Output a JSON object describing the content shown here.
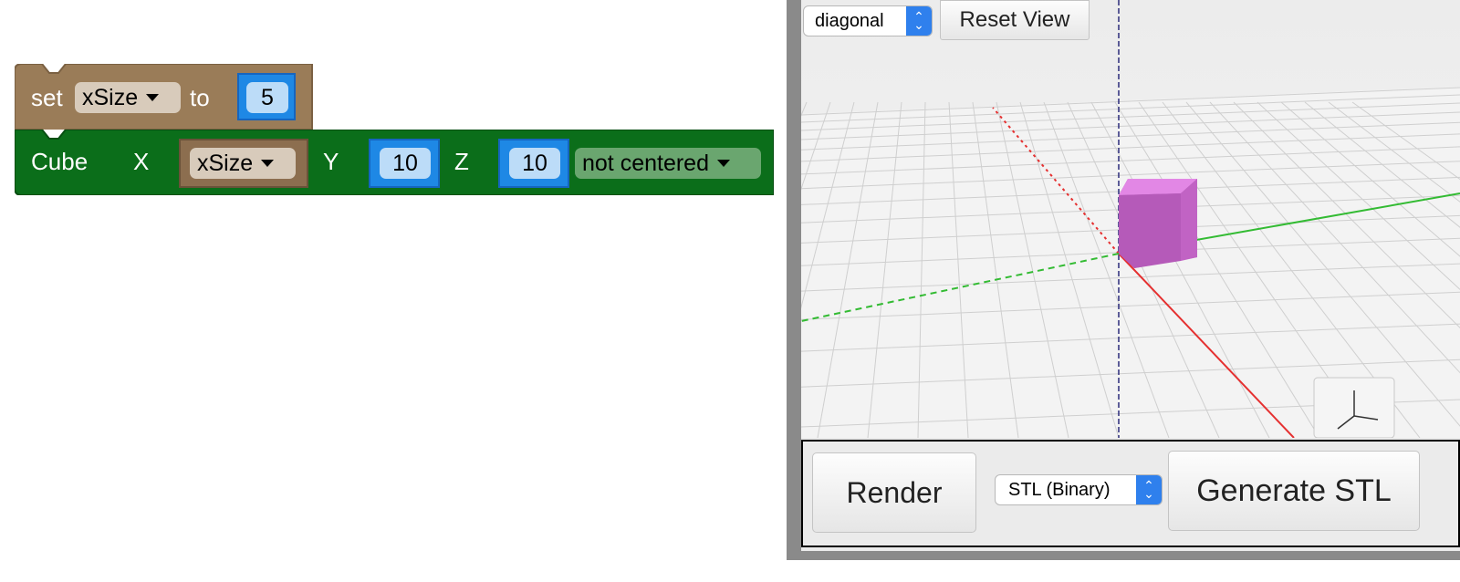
{
  "blocks": {
    "set_block": {
      "keyword_set": "set",
      "variable": "xSize",
      "keyword_to": "to",
      "value": "5",
      "color": "#9a7c58"
    },
    "cube_block": {
      "label": "Cube",
      "x_label": "X",
      "x_variable": "xSize",
      "y_label": "Y",
      "y_value": "10",
      "z_label": "Z",
      "z_value": "10",
      "center_option": "not centered",
      "color": "#0b6e1a"
    }
  },
  "viewer": {
    "view_select": "diagonal",
    "reset_view_label": "Reset View",
    "object_color": "#d06ad8",
    "axes_toggle_icon": "axes-icon",
    "grid": true
  },
  "bottom_bar": {
    "render_label": "Render",
    "format_select": "STL (Binary)",
    "generate_label": "Generate STL"
  }
}
